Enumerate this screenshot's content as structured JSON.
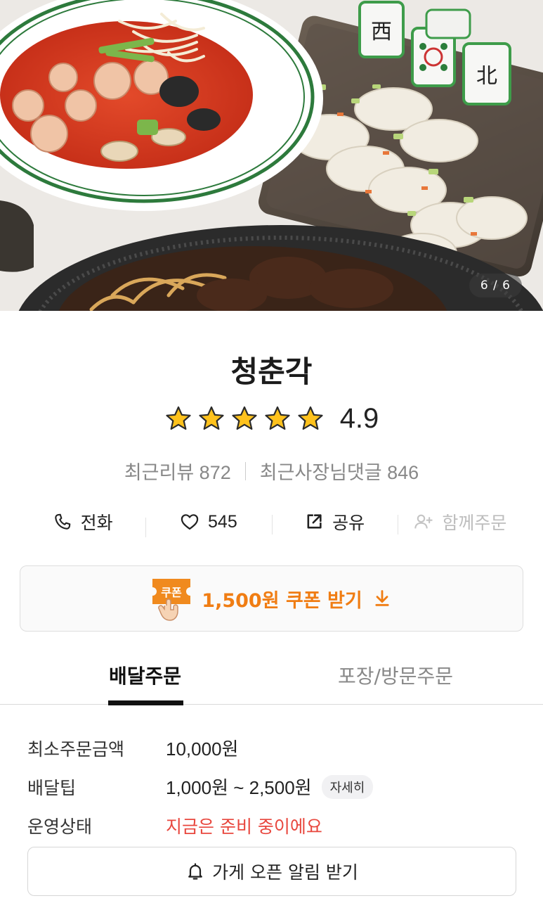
{
  "hero": {
    "image_counter": "6 / 6"
  },
  "store": {
    "name": "청춘각",
    "rating": {
      "value": "4.9",
      "stars_filled": 5,
      "stars_total": 5
    },
    "recent_reviews": "최근리뷰 872",
    "owner_replies": "최근사장님댓글 846"
  },
  "actions": {
    "call": "전화",
    "likes": "545",
    "share": "공유",
    "group_order": "함께주문"
  },
  "coupon": {
    "badge": "쿠폰",
    "label": "1,500원 쿠폰 받기"
  },
  "tabs": [
    {
      "label": "배달주문",
      "active": true
    },
    {
      "label": "포장/방문주문",
      "active": false
    }
  ],
  "info": {
    "min_order_label": "최소주문금액",
    "min_order_value": "10,000원",
    "delivery_tip_label": "배달팁",
    "delivery_tip_value": "1,000원 ~ 2,500원",
    "detail_button": "자세히",
    "status_label": "운영상태",
    "status_value": "지금은 준비 중이에요"
  },
  "notify_button": "가게 오픈 알림 받기",
  "colors": {
    "accent_orange": "#f07d13",
    "status_red": "#e8473e",
    "star_yellow": "#ffc21c"
  }
}
